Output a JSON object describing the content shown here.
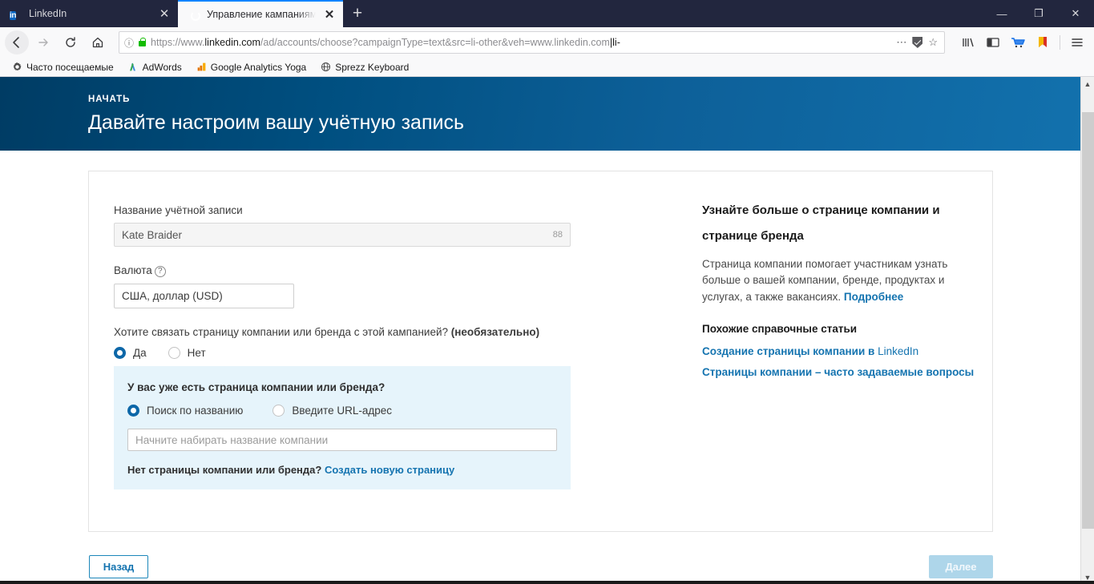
{
  "browser": {
    "tabs": [
      {
        "title": "LinkedIn",
        "favicon": "linkedin-icon",
        "active": false
      },
      {
        "title": "Управление кампаниями в LinkedIn",
        "favicon": "campaign-target-icon",
        "active": true
      }
    ],
    "new_tab_label": "+",
    "window_controls": {
      "minimize": "—",
      "maximize": "❐",
      "close": "✕"
    },
    "nav": {
      "back": "←",
      "forward": "→",
      "reload": "⟳",
      "home": "⌂"
    },
    "url": {
      "scheme": "https://www.",
      "domain": "linkedin.com",
      "path": "/ad/accounts/choose?campaignType=text&src=li-other&veh=www.linkedin.com",
      "tail": "|li-",
      "full": "https://www.linkedin.com/ad/accounts/choose?campaignType=text&src=li-other&veh=www.linkedin.com|li-",
      "info_icon": "page-info-icon",
      "lock_icon": "secure-lock-icon",
      "more_icon": "page-actions-icon",
      "shield_icon": "tracking-protection-icon",
      "bookmark_icon": "bookmark-star-icon"
    },
    "toolbar_icons": [
      "library-icon",
      "sidebar-icon",
      "shopping-cart-icon",
      "pocket-bookmark-icon",
      "app-menu-icon"
    ],
    "bookmarks": [
      {
        "label": "Часто посещаемые",
        "icon": "gear-icon"
      },
      {
        "label": "AdWords",
        "icon": "adwords-icon"
      },
      {
        "label": "Google Analytics Yoga",
        "icon": "analytics-icon"
      },
      {
        "label": "Sprezz Keyboard",
        "icon": "globe-icon"
      }
    ]
  },
  "hero": {
    "kicker": "НАЧАТЬ",
    "title": "Давайте настроим вашу учётную запись"
  },
  "form": {
    "account_name": {
      "label": "Название учётной записи",
      "value": "Kate Braider",
      "counter": "88"
    },
    "currency": {
      "label": "Валюта",
      "help_icon": "question-mark-icon",
      "value": "США, доллар (USD)"
    },
    "link_question": {
      "text": "Хотите связать страницу компании или бренда с этой кампанией? ",
      "emphasis": "(необязательно)",
      "options": [
        {
          "label": "Да",
          "selected": true
        },
        {
          "label": "Нет",
          "selected": false
        }
      ]
    },
    "company_panel": {
      "heading": "У вас уже есть страница компании или бренда?",
      "options": [
        {
          "label": "Поиск по названию",
          "selected": true
        },
        {
          "label": "Введите URL-адрес",
          "selected": false
        }
      ],
      "search_placeholder": "Начните набирать название компании",
      "footer_text": "Нет страницы компании или бренда? ",
      "footer_link": "Создать новую страницу"
    }
  },
  "help": {
    "title": "Узнайте больше о странице компании и странице бренда",
    "body": "Страница компании помогает участникам узнать больше о вашей компании, бренде, продуктах и услугах, а также вакансиях. ",
    "body_link": "Подробнее",
    "related_title": "Похожие справочные статьи",
    "links": [
      {
        "text": "Создание страницы компании в ",
        "brand": "LinkedIn"
      },
      {
        "text": "Страницы компании – часто задаваемые вопросы",
        "brand": ""
      }
    ]
  },
  "footer": {
    "back_label": "Назад",
    "next_label": "Далее"
  },
  "colors": {
    "hero_dark": "#003c64",
    "hero_light": "#1271ad",
    "link_blue": "#1574b0",
    "radio_blue": "#0d67a8",
    "panel_blue": "#e6f4fb",
    "next_disabled": "#aed6ea"
  }
}
